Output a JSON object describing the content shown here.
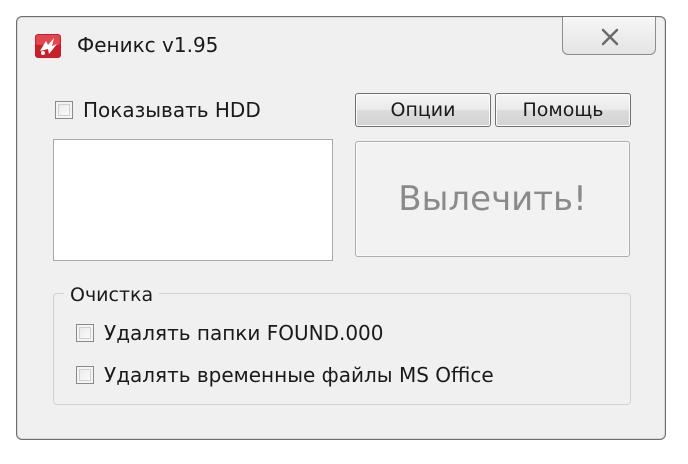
{
  "window": {
    "title": "Феникс v1.95"
  },
  "options": {
    "show_hdd_label": "Показывать HDD",
    "show_hdd_checked": false
  },
  "buttons": {
    "options_label": "Опции",
    "help_label": "Помощь",
    "cure_label": "Вылечить!"
  },
  "cleanup": {
    "group_title": "Очистка",
    "items": [
      {
        "label": "Удалять папки FOUND.000",
        "checked": false
      },
      {
        "label": "Удалять временные файлы MS Office",
        "checked": false
      }
    ]
  },
  "colors": {
    "window_bg": "#f0f0f0",
    "icon_red": "#c8202a",
    "disabled_text": "#8a8a8a"
  },
  "icons": {
    "app": "phoenix-app-icon",
    "close": "close-icon"
  }
}
